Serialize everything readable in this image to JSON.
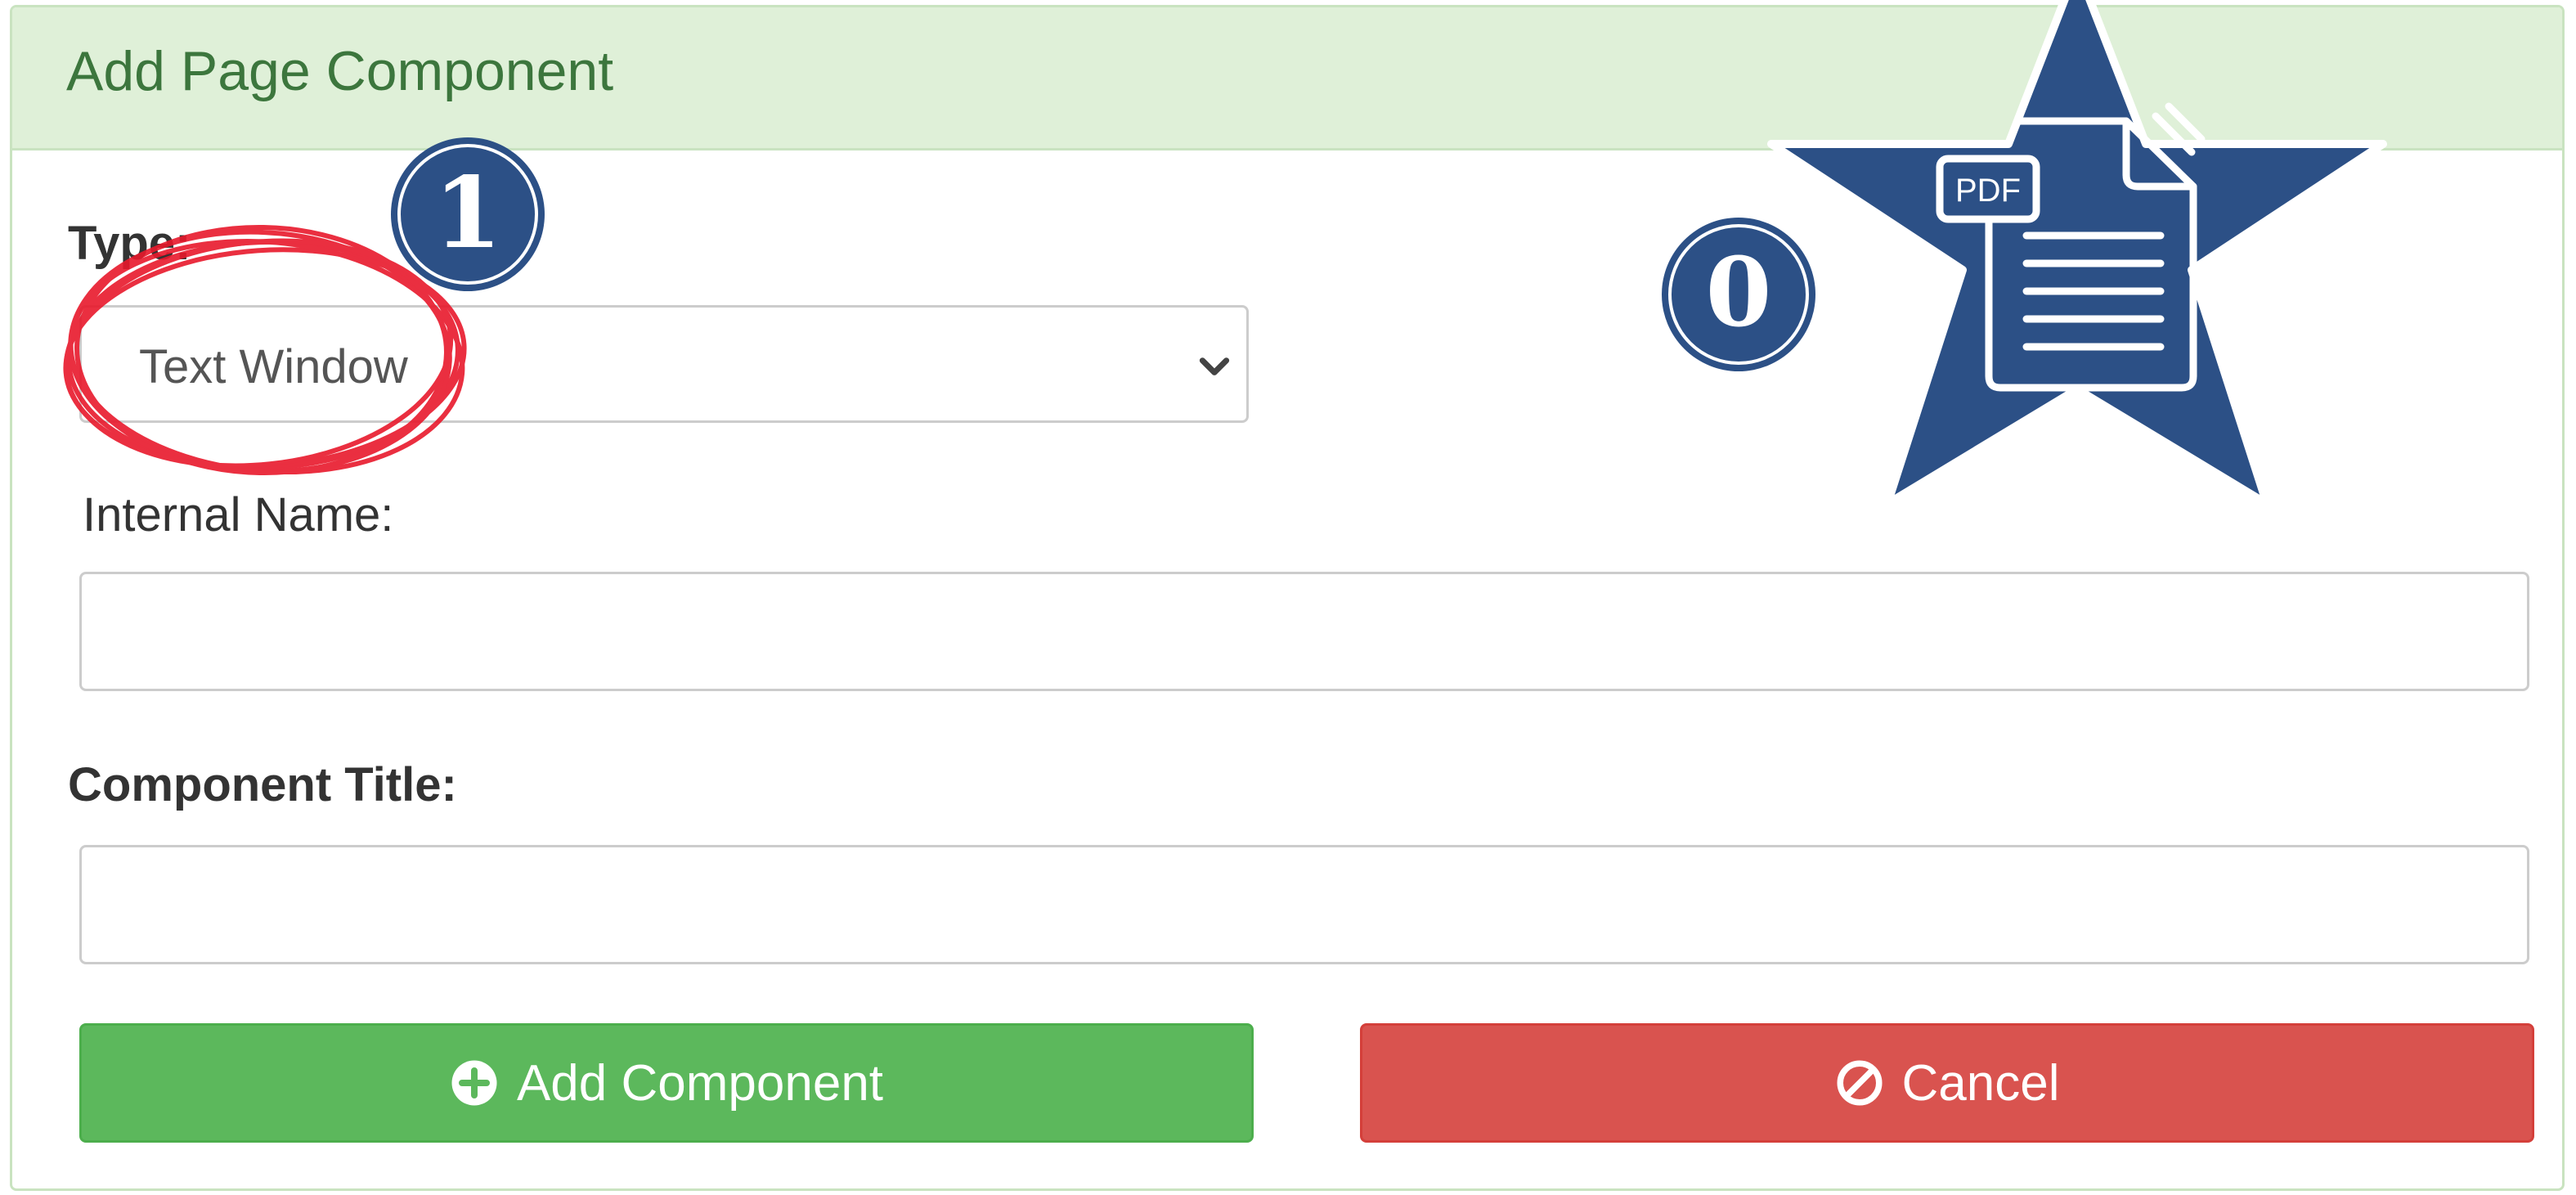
{
  "panel": {
    "title": "Add Page Component"
  },
  "form": {
    "type_label": "Type:",
    "type_selected": "Text Window",
    "internal_name_label": "Internal Name:",
    "internal_name_value": "",
    "component_title_label": "Component Title:",
    "component_title_value": ""
  },
  "buttons": {
    "add_label": "Add Component",
    "add_icon": "plus-circle-icon",
    "cancel_label": "Cancel",
    "cancel_icon": "ban-icon"
  },
  "annotations": {
    "badge_one": "1",
    "badge_zero": "0",
    "pdf_label": "PDF",
    "badge_color": "#2c5086",
    "circle_color": "#e8192c"
  },
  "colors": {
    "header_bg": "#dff0d8",
    "title_color": "#3c763d",
    "success": "#5cb85c",
    "danger": "#d9534f"
  }
}
